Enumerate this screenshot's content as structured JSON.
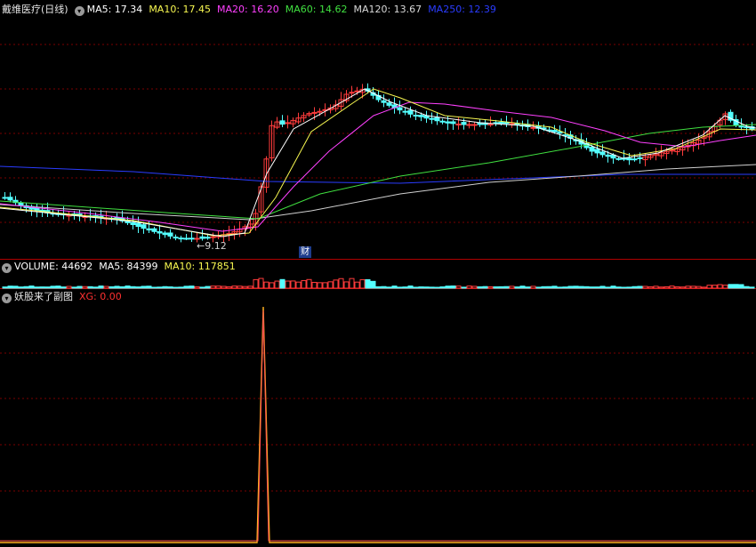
{
  "panels": {
    "price": {
      "title": "戴维医疗(日线)",
      "ma": [
        {
          "label": "MA5: 17.34",
          "color": "#ffffff"
        },
        {
          "label": "MA10: 17.45",
          "color": "#f7f750"
        },
        {
          "label": "MA20: 16.20",
          "color": "#ff40ff"
        },
        {
          "label": "MA60: 14.62",
          "color": "#40e040"
        },
        {
          "label": "MA120: 13.67",
          "color": "#d8d8d8"
        },
        {
          "label": "MA250: 12.39",
          "color": "#2a3cff"
        }
      ],
      "low_marker": "←9.12",
      "event_marker": "财"
    },
    "volume": {
      "items": [
        {
          "label": "VOLUME: 44692",
          "color": "#ffffff"
        },
        {
          "label": "MA5: 84399",
          "color": "#ffffff"
        },
        {
          "label": "MA10: 117851",
          "color": "#f7f750"
        }
      ]
    },
    "indicator": {
      "title": "妖股来了副图",
      "items": [
        {
          "label": "XG: 0.00",
          "color": "#ff3030"
        }
      ]
    }
  },
  "colors": {
    "up": "#ff3c3c",
    "down": "#54ffff",
    "grid": "#7a0000",
    "divider": "#b00000",
    "signal": "#ffb020"
  },
  "chart_data": [
    {
      "type": "candlestick",
      "title": "戴维医疗(日线)",
      "approx_price_range": [
        9.12,
        20.4
      ],
      "min_label": 9.12,
      "series": [
        {
          "name": "MA5",
          "last": 17.34
        },
        {
          "name": "MA10",
          "last": 17.45
        },
        {
          "name": "MA20",
          "last": 16.2
        },
        {
          "name": "MA60",
          "last": 14.62
        },
        {
          "name": "MA120",
          "last": 13.67
        },
        {
          "name": "MA250",
          "last": 12.39
        }
      ]
    },
    {
      "type": "bar",
      "title": "VOLUME",
      "series": [
        {
          "name": "VOLUME",
          "last": 44692
        },
        {
          "name": "MA5",
          "last": 84399
        },
        {
          "name": "MA10",
          "last": 117851
        }
      ]
    },
    {
      "type": "line",
      "title": "妖股来了副图",
      "series": [
        {
          "name": "XG",
          "last": 0.0,
          "peak": 1
        }
      ]
    }
  ]
}
